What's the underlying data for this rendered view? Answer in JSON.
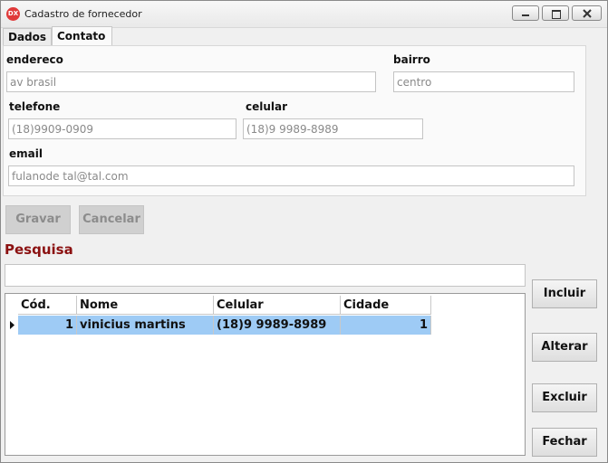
{
  "window": {
    "title": "Cadastro de fornecedor",
    "icon_text": "DX"
  },
  "tabs": [
    {
      "label": "Dados",
      "active": false
    },
    {
      "label": "Contato",
      "active": true
    }
  ],
  "form": {
    "endereco": {
      "label": "endereco",
      "value": "av brasil"
    },
    "bairro": {
      "label": "bairro",
      "value": "centro"
    },
    "telefone": {
      "label": "telefone",
      "value": "(18)9909-0909"
    },
    "celular": {
      "label": "celular",
      "value": "(18)9 9989-8989"
    },
    "email": {
      "label": "email",
      "value": "fulanode tal@tal.com"
    }
  },
  "form_buttons": {
    "save": "Gravar",
    "cancel": "Cancelar"
  },
  "search": {
    "label": "Pesquisa",
    "value": ""
  },
  "grid": {
    "columns": [
      "Cód.",
      "Nome",
      "Celular",
      "Cidade"
    ],
    "rows": [
      {
        "cod": "1",
        "nome": "vinicius martins",
        "celular": "(18)9 9989-8989",
        "cidade": "1"
      }
    ]
  },
  "side_buttons": {
    "include": "Incluir",
    "edit": "Alterar",
    "delete": "Excluir",
    "close": "Fechar"
  },
  "colors": {
    "selected_row": "#9ecbf5",
    "search_label": "#8b1111",
    "app_icon": "#e03a3a"
  }
}
